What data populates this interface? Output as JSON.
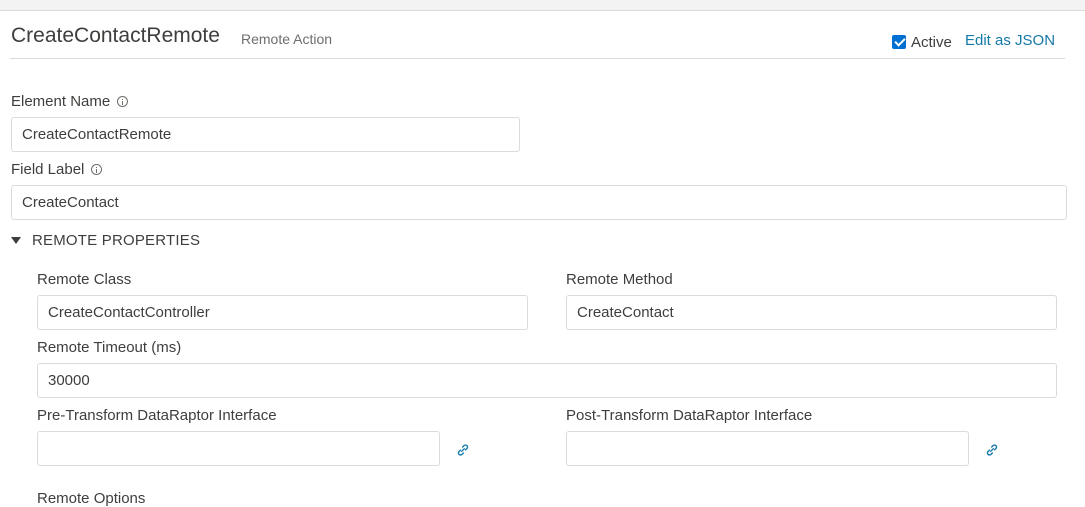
{
  "header": {
    "title": "CreateContactRemote",
    "subtitle": "Remote Action",
    "active_label": "Active",
    "active_checked": true,
    "edit_json_label": "Edit as JSON"
  },
  "fields": {
    "element_name": {
      "label": "Element Name",
      "value": "CreateContactRemote"
    },
    "field_label": {
      "label": "Field Label",
      "value": "CreateContact"
    }
  },
  "remote_properties": {
    "section_title": "REMOTE PROPERTIES",
    "expanded": true,
    "remote_class": {
      "label": "Remote Class",
      "value": "CreateContactController"
    },
    "remote_method": {
      "label": "Remote Method",
      "value": "CreateContact"
    },
    "remote_timeout": {
      "label": "Remote Timeout (ms)",
      "value": "30000"
    },
    "pre_transform": {
      "label": "Pre-Transform DataRaptor Interface",
      "value": ""
    },
    "post_transform": {
      "label": "Post-Transform DataRaptor Interface",
      "value": ""
    },
    "next_label_partial": "Remote Options"
  },
  "icons": {
    "info": "info-icon",
    "link": "link-icon",
    "section_toggle": "triangle-down-icon",
    "checkbox": "checkbox-checked-icon"
  },
  "colors": {
    "accent": "#0070d2",
    "link": "#1478a8",
    "border": "#dddbda",
    "text": "#3e3e3c",
    "muted": "#706e6b"
  }
}
